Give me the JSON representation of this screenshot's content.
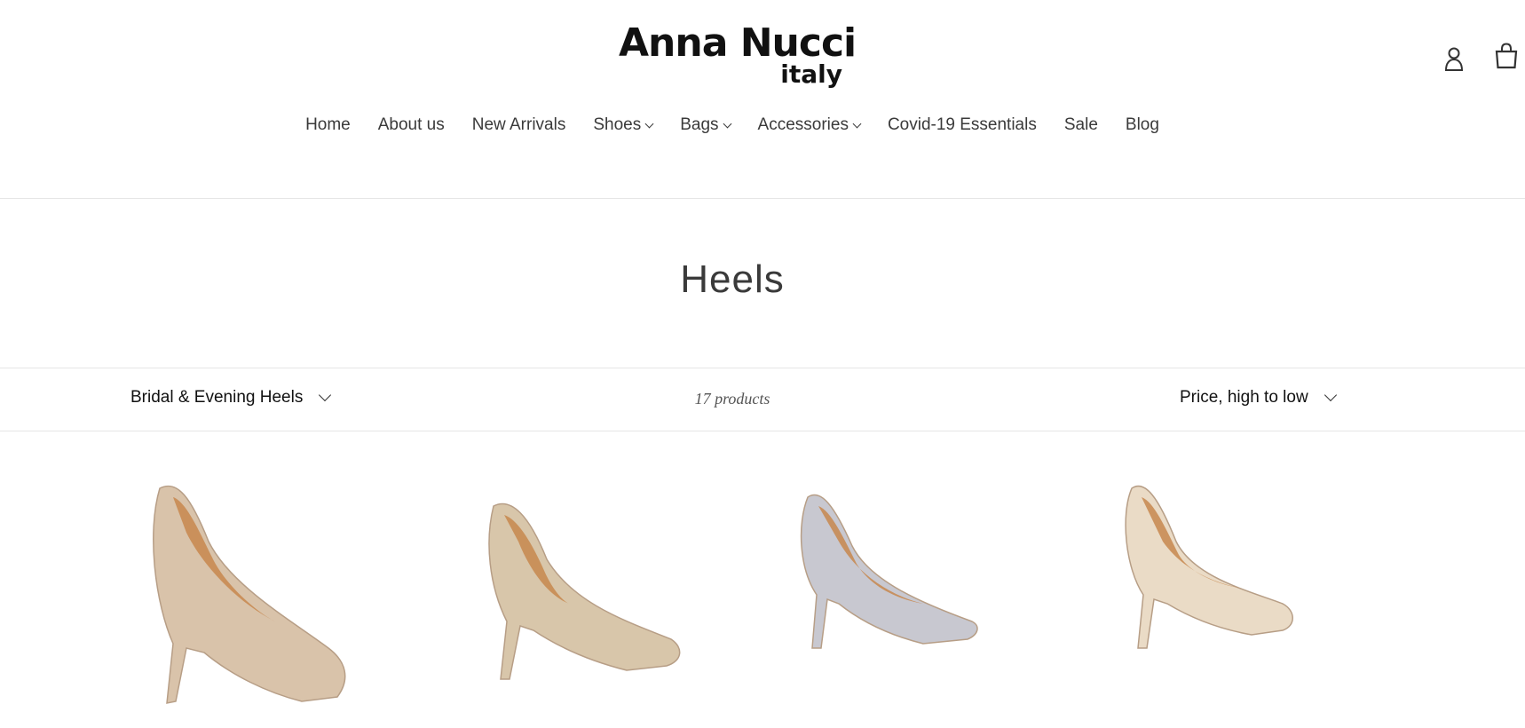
{
  "brand": {
    "name": "Anna Nucci",
    "sub": "italy"
  },
  "header": {
    "login_icon": "person-icon",
    "cart_icon": "shopping-bag-icon"
  },
  "nav": [
    {
      "label": "Home",
      "dropdown": false
    },
    {
      "label": "About us",
      "dropdown": false
    },
    {
      "label": "New Arrivals",
      "dropdown": false
    },
    {
      "label": "Shoes",
      "dropdown": true
    },
    {
      "label": "Bags",
      "dropdown": true
    },
    {
      "label": "Accessories",
      "dropdown": true
    },
    {
      "label": "Covid-19 Essentials",
      "dropdown": false
    },
    {
      "label": "Sale",
      "dropdown": false
    },
    {
      "label": "Blog",
      "dropdown": false
    }
  ],
  "collection": {
    "title": "Heels"
  },
  "toolbar": {
    "filter_value": "Bridal & Evening Heels",
    "product_count": "17 products",
    "sort_value": "Price, high to low"
  },
  "products": [
    {
      "image": "rhinestone-platform-pump",
      "color": "#d9c3aa"
    },
    {
      "image": "rhinestone-dorsay-pump",
      "color": "#d8c6aa"
    },
    {
      "image": "silver-glitter-pump",
      "color": "#c8c8d0"
    },
    {
      "image": "champagne-satin-pump",
      "color": "#eadbc6"
    }
  ]
}
